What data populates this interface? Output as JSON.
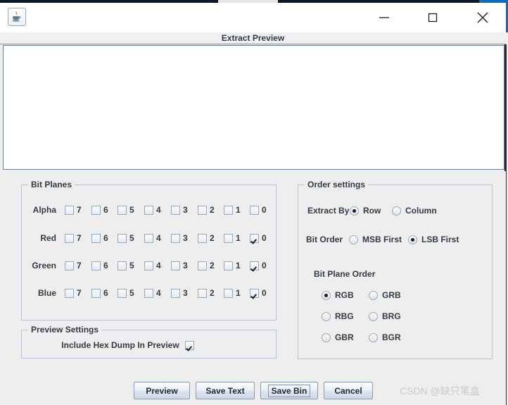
{
  "window": {
    "app_icon": "java-coffee-cup-icon",
    "minimize_label": "—",
    "maximize_label": "□",
    "close_label": "✕"
  },
  "preview": {
    "header_title": "Extract Preview",
    "text_area_value": ""
  },
  "bit_planes": {
    "title": "Bit Planes",
    "bit_labels": [
      "7",
      "6",
      "5",
      "4",
      "3",
      "2",
      "1",
      "0"
    ],
    "rows": [
      {
        "label": "Alpha",
        "checked": [
          false,
          false,
          false,
          false,
          false,
          false,
          false,
          false
        ]
      },
      {
        "label": "Red",
        "checked": [
          false,
          false,
          false,
          false,
          false,
          false,
          false,
          true
        ]
      },
      {
        "label": "Green",
        "checked": [
          false,
          false,
          false,
          false,
          false,
          false,
          false,
          true
        ]
      },
      {
        "label": "Blue",
        "checked": [
          false,
          false,
          false,
          false,
          false,
          false,
          false,
          true
        ]
      }
    ]
  },
  "preview_settings": {
    "title": "Preview Settings",
    "hex_dump_label": "Include Hex Dump In Preview",
    "hex_dump_checked": true
  },
  "order_settings": {
    "title": "Order settings",
    "extract_by_label": "Extract By",
    "extract_by_options": [
      {
        "label": "Row",
        "selected": true
      },
      {
        "label": "Column",
        "selected": false
      }
    ],
    "bit_order_label": "Bit Order",
    "bit_order_options": [
      {
        "label": "MSB First",
        "selected": false
      },
      {
        "label": "LSB First",
        "selected": true
      }
    ],
    "bit_plane_order_label": "Bit Plane Order",
    "bit_plane_order_options": [
      {
        "label": "RGB",
        "selected": true
      },
      {
        "label": "GRB",
        "selected": false
      },
      {
        "label": "RBG",
        "selected": false
      },
      {
        "label": "BRG",
        "selected": false
      },
      {
        "label": "GBR",
        "selected": false
      },
      {
        "label": "BGR",
        "selected": false
      }
    ]
  },
  "buttons": {
    "preview": "Preview",
    "save_text": "Save Text",
    "save_bin": "Save Bin",
    "cancel": "Cancel",
    "focused": "save_bin"
  },
  "watermark": {
    "text": "CSDN @缺只笔盒"
  },
  "colors": {
    "panel_background": "#eeeeee",
    "group_border": "#b8c4d0",
    "text": "#333a42",
    "preview_area_background": "#ffffff",
    "accent_blue": "#0f6cbd"
  }
}
